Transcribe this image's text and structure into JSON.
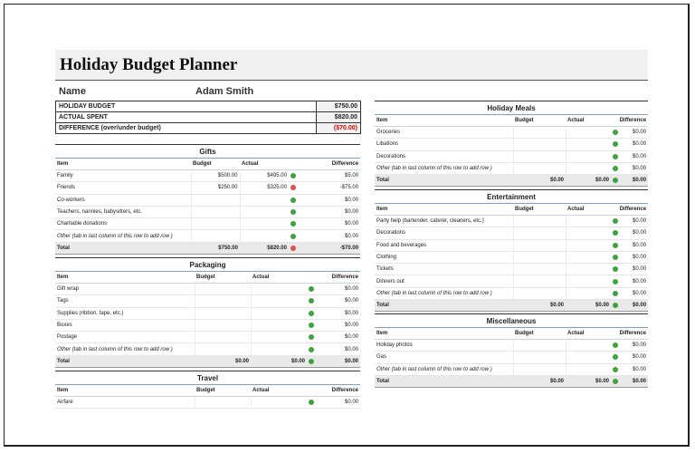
{
  "title": "Holiday Budget Planner",
  "name_label": "Name",
  "name_value": "Adam Smith",
  "summary": [
    {
      "label": "HOLIDAY BUDGET",
      "value": "$750.00",
      "negative": false
    },
    {
      "label": "ACTUAL SPENT",
      "value": "$820.00",
      "negative": false
    },
    {
      "label": "DIFFERENCE (over/under budget)",
      "value": "($70.00)",
      "negative": true
    }
  ],
  "columns": {
    "item": "Item",
    "budget": "Budget",
    "actual": "Actual",
    "difference": "Difference"
  },
  "gifts": {
    "title": "Gifts",
    "rows": [
      {
        "item": "Family",
        "budget": "$500.00",
        "actual": "$495.00",
        "diff": "$5.00",
        "status": "green"
      },
      {
        "item": "Friends",
        "budget": "$250.00",
        "actual": "$325.00",
        "diff": "-$75.00",
        "status": "red"
      },
      {
        "item": "Co-workers",
        "budget": "",
        "actual": "",
        "diff": "$0.00",
        "status": "green"
      },
      {
        "item": "Teachers, nannies, babysitters, etc.",
        "budget": "",
        "actual": "",
        "diff": "$0.00",
        "status": "green"
      },
      {
        "item": "Charitable donations",
        "budget": "",
        "actual": "",
        "diff": "$0.00",
        "status": "green"
      },
      {
        "item": "Other (tab in last column of this row to add row )",
        "budget": "",
        "actual": "",
        "diff": "$0.00",
        "status": "green",
        "italic": true
      }
    ],
    "total": {
      "label": "Total",
      "budget": "$750.00",
      "actual": "$820.00",
      "diff": "-$70.00",
      "status": "red"
    }
  },
  "packaging": {
    "title": "Packaging",
    "rows": [
      {
        "item": "Gift wrap",
        "budget": "",
        "actual": "",
        "diff": "$0.00",
        "status": "green"
      },
      {
        "item": "Tags",
        "budget": "",
        "actual": "",
        "diff": "$0.00",
        "status": "green"
      },
      {
        "item": "Supplies (ribbon, tape, etc.)",
        "budget": "",
        "actual": "",
        "diff": "$0.00",
        "status": "green"
      },
      {
        "item": "Boxes",
        "budget": "",
        "actual": "",
        "diff": "$0.00",
        "status": "green"
      },
      {
        "item": "Postage",
        "budget": "",
        "actual": "",
        "diff": "$0.00",
        "status": "green"
      },
      {
        "item": "Other (tab in last column of this row to add row )",
        "budget": "",
        "actual": "",
        "diff": "$0.00",
        "status": "green",
        "italic": true
      }
    ],
    "total": {
      "label": "Total",
      "budget": "$0.00",
      "actual": "$0.00",
      "diff": "$0.00",
      "status": "green"
    }
  },
  "travel": {
    "title": "Travel",
    "rows": [
      {
        "item": "Airfare",
        "budget": "",
        "actual": "",
        "diff": "$0.00",
        "status": "green"
      }
    ]
  },
  "meals": {
    "title": "Holiday Meals",
    "rows": [
      {
        "item": "Groceries",
        "budget": "",
        "actual": "",
        "diff": "$0.00",
        "status": "green"
      },
      {
        "item": "Libations",
        "budget": "",
        "actual": "",
        "diff": "$0.00",
        "status": "green"
      },
      {
        "item": "Decorations",
        "budget": "",
        "actual": "",
        "diff": "$0.00",
        "status": "green"
      },
      {
        "item": "Other (tab in last column of this row to add row )",
        "budget": "",
        "actual": "",
        "diff": "$0.00",
        "status": "green",
        "italic": true
      }
    ],
    "total": {
      "label": "Total",
      "budget": "$0.00",
      "actual": "$0.00",
      "diff": "$0.00",
      "status": "green"
    }
  },
  "entertainment": {
    "title": "Entertainment",
    "rows": [
      {
        "item": "Party help (bartender, caterer, cleaners, etc.)",
        "budget": "",
        "actual": "",
        "diff": "$0.00",
        "status": "green"
      },
      {
        "item": "Decorations",
        "budget": "",
        "actual": "",
        "diff": "$0.00",
        "status": "green"
      },
      {
        "item": "Food and beverages",
        "budget": "",
        "actual": "",
        "diff": "$0.00",
        "status": "green"
      },
      {
        "item": "Clothing",
        "budget": "",
        "actual": "",
        "diff": "$0.00",
        "status": "green"
      },
      {
        "item": "Tickets",
        "budget": "",
        "actual": "",
        "diff": "$0.00",
        "status": "green"
      },
      {
        "item": "Dinners out",
        "budget": "",
        "actual": "",
        "diff": "$0.00",
        "status": "green"
      },
      {
        "item": "Other (tab in last column of this row to add row )",
        "budget": "",
        "actual": "",
        "diff": "$0.00",
        "status": "green",
        "italic": true
      }
    ],
    "total": {
      "label": "Total",
      "budget": "$0.00",
      "actual": "$0.00",
      "diff": "$0.00",
      "status": "green"
    }
  },
  "misc": {
    "title": "Miscellaneous",
    "rows": [
      {
        "item": "Holiday photos",
        "budget": "",
        "actual": "",
        "diff": "$0.00",
        "status": "green"
      },
      {
        "item": "Gas",
        "budget": "",
        "actual": "",
        "diff": "$0.00",
        "status": "green"
      },
      {
        "item": "Other (tab in last column of this row to add row )",
        "budget": "",
        "actual": "",
        "diff": "$0.00",
        "status": "green",
        "italic": true
      }
    ],
    "total": {
      "label": "Total",
      "budget": "$0.00",
      "actual": "$0.00",
      "diff": "$0.00",
      "status": "green"
    }
  },
  "colors": {
    "ok": "#3ea33e",
    "over": "#e05050",
    "negative_text": "#e00000"
  }
}
